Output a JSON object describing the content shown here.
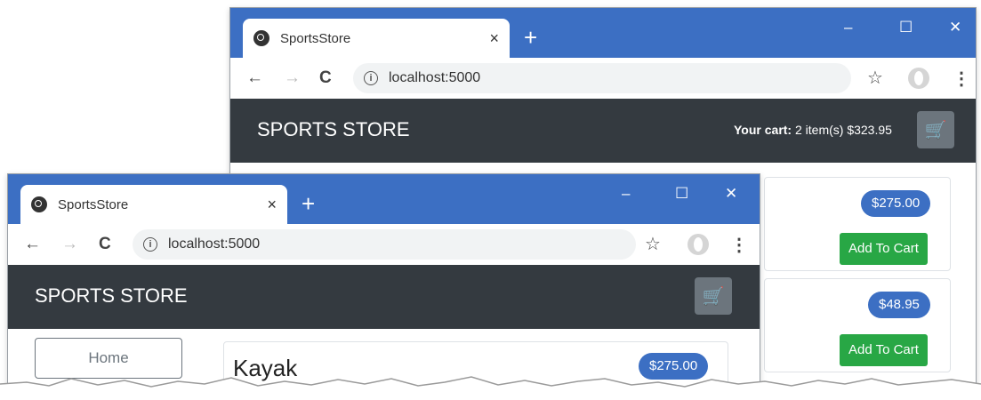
{
  "back_window": {
    "tab_title": "SportsStore",
    "tab_close": "×",
    "new_tab": "+",
    "controls": {
      "minimize": "–",
      "maximize": "☐",
      "close": "✕"
    },
    "url": "localhost:5000",
    "brand": "SPORTS STORE",
    "cart": {
      "label": "Your cart:",
      "text": "2 item(s) $323.95"
    },
    "products": [
      {
        "price": "$275.00",
        "button": "Add To Cart"
      },
      {
        "price": "$48.95",
        "button": "Add To Cart"
      }
    ]
  },
  "front_window": {
    "tab_title": "SportsStore",
    "tab_close": "×",
    "new_tab": "+",
    "controls": {
      "minimize": "–",
      "maximize": "☐",
      "close": "✕"
    },
    "url": "localhost:5000",
    "brand": "SPORTS STORE",
    "home_button": "Home",
    "product": {
      "name": "Kayak",
      "price": "$275.00"
    }
  },
  "icons": {
    "back": "←",
    "forward": "→",
    "reload": "C",
    "info": "i",
    "star": "☆",
    "menu": "⋮",
    "cart": "🛒"
  },
  "colors": {
    "titlebar": "#3c6fc3",
    "navbar": "#343a40",
    "badge": "#3c6fc3",
    "add_button": "#28a745"
  }
}
